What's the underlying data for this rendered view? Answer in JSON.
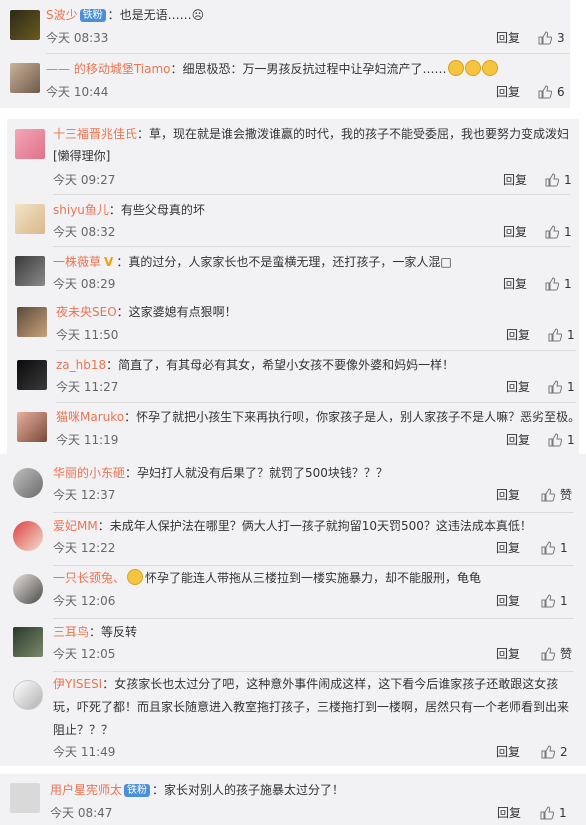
{
  "reply_label": "回复",
  "comments": [
    {
      "user": "S波少",
      "badge": "铁粉",
      "sep": "：",
      "text": "也是无语……",
      "smile": "☹",
      "time": "今天 08:33",
      "likes": "3"
    },
    {
      "user": "—— 的移动城堡Tiamo",
      "sep": "：",
      "text": "细思极恐：万一男孩反抗过程中让孕妇流产了……",
      "emoji_count": 3,
      "time": "今天 10:44",
      "likes": "6"
    },
    {
      "user": "十三福晋兆佳氏",
      "sep": "：",
      "text": "草，现在就是谁会撒泼谁赢的时代，我的孩子不能受委屈，我也要努力变成泼妇",
      "text2": "[懒得理你]",
      "time": "今天 09:27",
      "likes": "1"
    },
    {
      "user": "shiyu鱼儿",
      "sep": "：",
      "text": "有些父母真的坏",
      "time": "今天 08:32",
      "likes": "1"
    },
    {
      "user": "一株薇草",
      "vbadge": "V",
      "sep": "：",
      "text": "真的过分，人家家长也不是蛮横无理，还打孩子，一家人混□",
      "time": "今天 08:29",
      "likes": "1"
    },
    {
      "user": "夜未央SEO",
      "sep": "：",
      "text": "这家婆媳有点狠啊！",
      "time": "今天 11:50",
      "likes": "1"
    },
    {
      "user": "za_hb18",
      "sep": "：",
      "text": "简直了，有其母必有其女，希望小女孩不要像外婆和妈妈一样！",
      "time": "今天 11:27",
      "likes": "1"
    },
    {
      "user": "猫咪Maruko",
      "sep": "：",
      "text": "怀孕了就把小孩生下来再执行呗，你家孩子是人，别人家孩子不是人嘛？恶劣至极。",
      "time": "今天 11:19",
      "likes": "1"
    },
    {
      "user": "华丽的小东砸",
      "sep": "：",
      "text": "孕妇打人就没有后果了？就罚了500块钱？？？",
      "time": "今天 12:37",
      "likes": "赞"
    },
    {
      "user": "爱妃MM",
      "sep": "：",
      "text": "未成年人保护法在哪里？俩大人打一孩子就拘留10天罚500？这违法成本真低！",
      "time": "今天 12:22",
      "likes": "1"
    },
    {
      "user": "一只长颈兔、",
      "sep": "：",
      "text": "怀孕了能连人带拖从三楼拉到一楼实施暴力，却不能服刑，龟龟",
      "emoji_before": true,
      "time": "今天 12:06",
      "likes": "1"
    },
    {
      "user": "三耳鸟",
      "sep": "：",
      "text": "等反转",
      "time": "今天 12:05",
      "likes": "赞"
    },
    {
      "user": "伊YISESI",
      "sep": "：",
      "text": "女孩家长也太过分了吧，这种意外事件闹成这样，这下看今后谁家孩子还敢跟这女孩",
      "text2": "玩，吓死了都！而且家长随意进入教室拖打孩子，三楼拖打到一楼啊，居然只有一个老师看到出来",
      "text3": "阻止？？？",
      "time": "今天 11:49",
      "likes": "2"
    },
    {
      "user": "用户星宪师太",
      "badge": "铁粉",
      "sep": "：",
      "text": "家长对别人的孩子施暴太过分了！",
      "time": "今天 08:47",
      "likes": "1"
    }
  ]
}
